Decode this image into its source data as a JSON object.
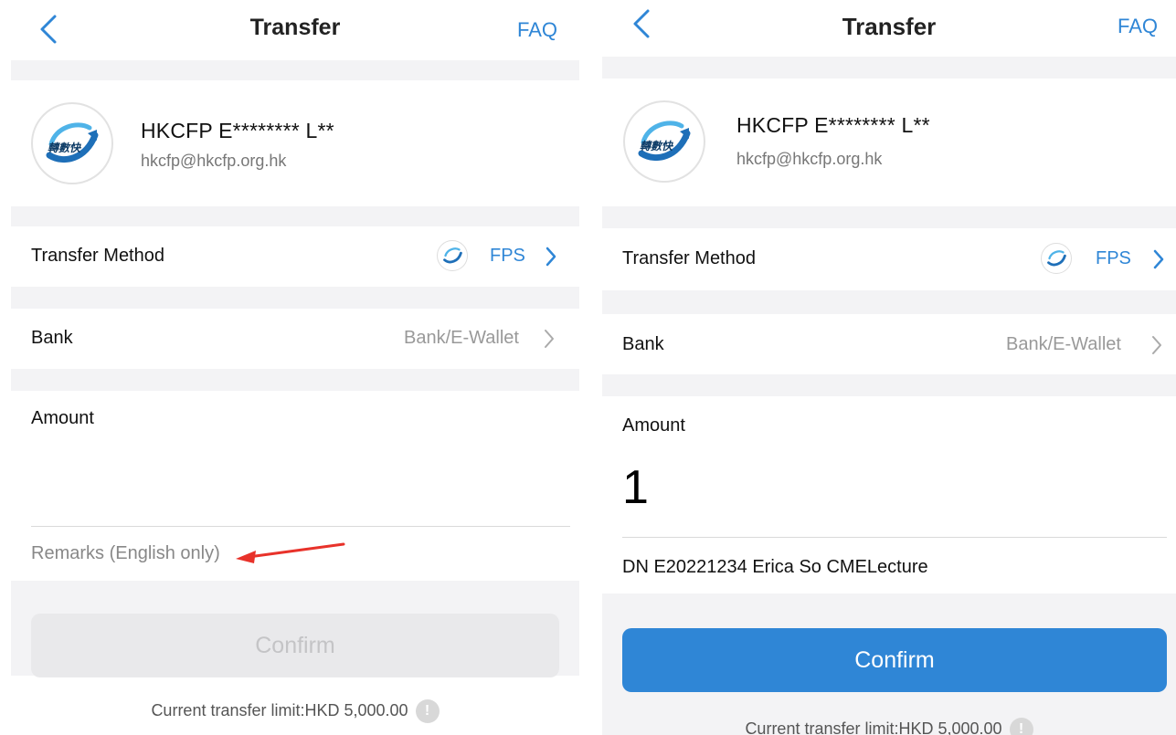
{
  "left": {
    "nav": {
      "title": "Transfer",
      "faq": "FAQ"
    },
    "payee": {
      "name": "HKCFP E******** L**",
      "email": "hkcfp@hkcfp.org.hk"
    },
    "transfer_method": {
      "label": "Transfer Method",
      "value": "FPS"
    },
    "bank": {
      "label": "Bank",
      "value": "Bank/E-Wallet"
    },
    "amount": {
      "label": "Amount",
      "value": ""
    },
    "remarks": {
      "placeholder": "Remarks (English only)"
    },
    "confirm": {
      "label": "Confirm",
      "state": "disabled"
    },
    "limit": "Current transfer limit:HKD 5,000.00"
  },
  "right": {
    "nav": {
      "title": "Transfer",
      "faq": "FAQ"
    },
    "payee": {
      "name": "HKCFP E******** L**",
      "email": "hkcfp@hkcfp.org.hk"
    },
    "transfer_method": {
      "label": "Transfer Method",
      "value": "FPS"
    },
    "bank": {
      "label": "Bank",
      "value": "Bank/E-Wallet"
    },
    "amount": {
      "label": "Amount",
      "value": "1"
    },
    "remarks": {
      "value": "DN E20221234 Erica So CMELecture"
    },
    "confirm": {
      "label": "Confirm",
      "state": "enabled"
    },
    "limit": "Current transfer limit:HKD 5,000.00"
  },
  "icons": {
    "info": "!"
  },
  "colors": {
    "accent": "#2f86d6",
    "annotation_arrow": "#e8322a",
    "section_gap": "#f3f3f5"
  }
}
